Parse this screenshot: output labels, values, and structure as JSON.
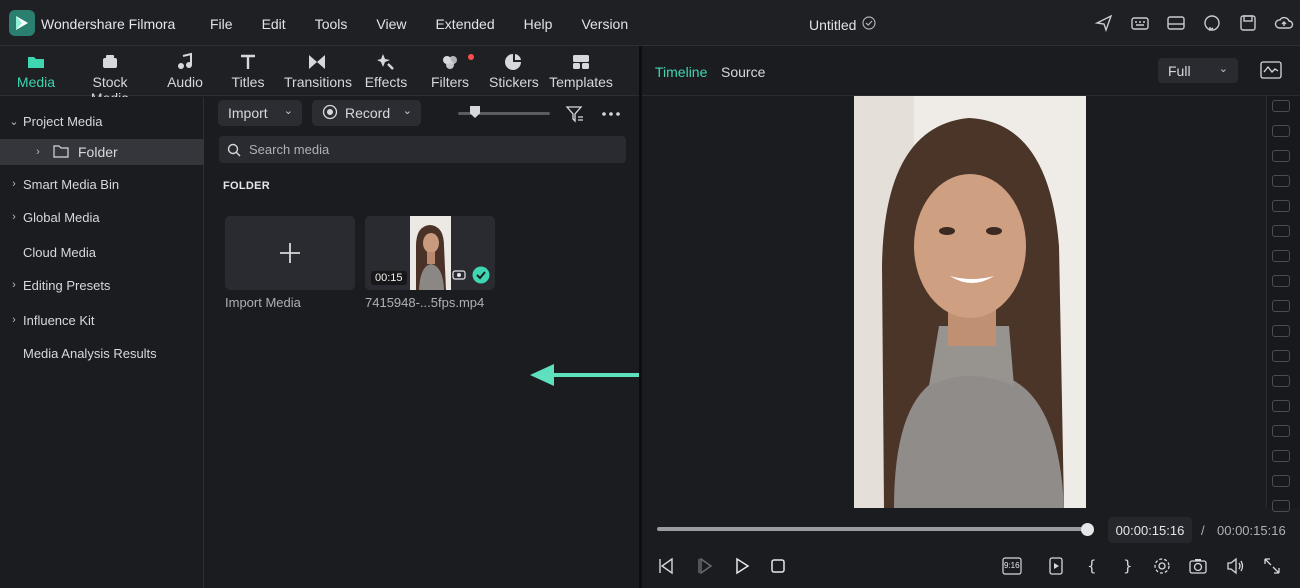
{
  "app": {
    "name": "Wondershare Filmora",
    "document_title": "Untitled"
  },
  "menu": [
    "File",
    "Edit",
    "Tools",
    "View",
    "Extended",
    "Help",
    "Version"
  ],
  "title_icons": [
    "send-icon",
    "keyboard-icon",
    "layout-icon",
    "support-icon",
    "save-icon",
    "cloud-upload-icon"
  ],
  "library_tabs": [
    {
      "label": "Media",
      "icon": "media-icon",
      "active": true
    },
    {
      "label": "Stock Media",
      "icon": "stock-media-icon"
    },
    {
      "label": "Audio",
      "icon": "music-note-icon"
    },
    {
      "label": "Titles",
      "icon": "text-icon"
    },
    {
      "label": "Transitions",
      "icon": "transitions-icon"
    },
    {
      "label": "Effects",
      "icon": "effects-icon"
    },
    {
      "label": "Filters",
      "icon": "filters-icon"
    },
    {
      "label": "Stickers",
      "icon": "stickers-icon"
    },
    {
      "label": "Templates",
      "icon": "templates-icon"
    }
  ],
  "sidebar": {
    "items": [
      {
        "label": "Project Media",
        "expanded": true
      },
      {
        "label": "Folder",
        "selected": true
      },
      {
        "label": "Smart Media Bin"
      },
      {
        "label": "Global Media"
      },
      {
        "label": "Cloud Media"
      },
      {
        "label": "Editing Presets"
      },
      {
        "label": "Influence Kit"
      },
      {
        "label": "Media Analysis Results"
      }
    ]
  },
  "media": {
    "import_label": "Import",
    "record_label": "Record",
    "search_placeholder": "Search media",
    "section_heading": "FOLDER",
    "import_tile_label": "Import Media",
    "clip": {
      "name": "7415948-...5fps.mp4",
      "duration": "00:15"
    }
  },
  "preview": {
    "tabs": [
      "Timeline",
      "Source"
    ],
    "active_tab": "Timeline",
    "zoom": "Full",
    "playhead_fraction": 1.0,
    "current_time": "00:00:15:16",
    "separator": "/",
    "total_time": "00:00:15:16",
    "aspect_ratio": "9:16"
  },
  "colors": {
    "accent": "#3fd5b0",
    "arrow": "#5ee0be",
    "panel_bg": "#1b1c20",
    "divider": "#0d0e10"
  }
}
